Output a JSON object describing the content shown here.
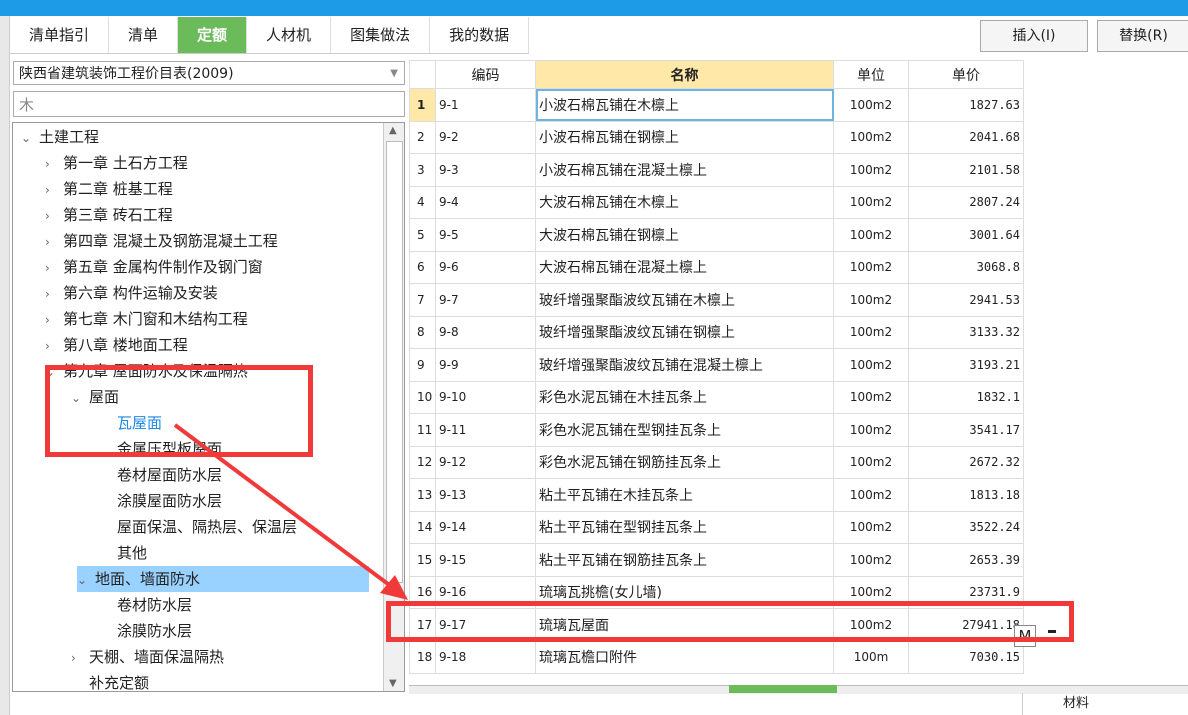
{
  "tabs": [
    "清单指引",
    "清单",
    "定额",
    "人材机",
    "图集做法",
    "我的数据"
  ],
  "active_tab": 2,
  "buttons": {
    "insert": "插入(I)",
    "replace": "替换(R)"
  },
  "library": "陕西省建筑装饰工程价目表(2009)",
  "search_value": "木",
  "tree": [
    {
      "label": "土建工程",
      "level": 0,
      "caret": "down"
    },
    {
      "label": "第一章 土石方工程",
      "level": 1,
      "caret": "right"
    },
    {
      "label": "第二章 桩基工程",
      "level": 1,
      "caret": "right"
    },
    {
      "label": "第三章 砖石工程",
      "level": 1,
      "caret": "right"
    },
    {
      "label": "第四章 混凝土及钢筋混凝土工程",
      "level": 1,
      "caret": "right"
    },
    {
      "label": "第五章 金属构件制作及钢门窗",
      "level": 1,
      "caret": "right"
    },
    {
      "label": "第六章 构件运输及安装",
      "level": 1,
      "caret": "right"
    },
    {
      "label": "第七章 木门窗和木结构工程",
      "level": 1,
      "caret": "right"
    },
    {
      "label": "第八章 楼地面工程",
      "level": 1,
      "caret": "right"
    },
    {
      "label": "第九章 屋面防水及保温隔热",
      "level": 1,
      "caret": "down"
    },
    {
      "label": "屋面",
      "level": 2,
      "caret": "down"
    },
    {
      "label": "瓦屋面",
      "level": 3,
      "caret": "",
      "state": "link"
    },
    {
      "label": "金属压型板屋面",
      "level": 3,
      "caret": ""
    },
    {
      "label": "卷材屋面防水层",
      "level": 3,
      "caret": ""
    },
    {
      "label": "涂膜屋面防水层",
      "level": 3,
      "caret": ""
    },
    {
      "label": "屋面保温、隔热层、保温层",
      "level": 3,
      "caret": ""
    },
    {
      "label": "其他",
      "level": 3,
      "caret": ""
    },
    {
      "label": "地面、墙面防水",
      "level": 2,
      "caret": "down",
      "state": "sel"
    },
    {
      "label": "卷材防水层",
      "level": 3,
      "caret": ""
    },
    {
      "label": "涂膜防水层",
      "level": 3,
      "caret": ""
    },
    {
      "label": "天棚、墙面保温隔热",
      "level": 2,
      "caret": "right"
    },
    {
      "label": "补充定额",
      "level": 2,
      "caret": ""
    }
  ],
  "grid": {
    "headers": [
      "",
      "编码",
      "名称",
      "单位",
      "单价"
    ],
    "rows": [
      [
        "1",
        "9-1",
        "小波石棉瓦铺在木檩上",
        "100m2",
        "1827.63"
      ],
      [
        "2",
        "9-2",
        "小波石棉瓦铺在钢檩上",
        "100m2",
        "2041.68"
      ],
      [
        "3",
        "9-3",
        "小波石棉瓦铺在混凝土檩上",
        "100m2",
        "2101.58"
      ],
      [
        "4",
        "9-4",
        "大波石棉瓦铺在木檩上",
        "100m2",
        "2807.24"
      ],
      [
        "5",
        "9-5",
        "大波石棉瓦铺在钢檩上",
        "100m2",
        "3001.64"
      ],
      [
        "6",
        "9-6",
        "大波石棉瓦铺在混凝土檩上",
        "100m2",
        "3068.8"
      ],
      [
        "7",
        "9-7",
        "玻纤增强聚酯波纹瓦铺在木檩上",
        "100m2",
        "2941.53"
      ],
      [
        "8",
        "9-8",
        "玻纤增强聚酯波纹瓦铺在钢檩上",
        "100m2",
        "3133.32"
      ],
      [
        "9",
        "9-9",
        "玻纤增强聚酯波纹瓦铺在混凝土檩上",
        "100m2",
        "3193.21"
      ],
      [
        "10",
        "9-10",
        "彩色水泥瓦铺在木挂瓦条上",
        "100m2",
        "1832.1"
      ],
      [
        "11",
        "9-11",
        "彩色水泥瓦铺在型钢挂瓦条上",
        "100m2",
        "3541.17"
      ],
      [
        "12",
        "9-12",
        "彩色水泥瓦铺在钢筋挂瓦条上",
        "100m2",
        "2672.32"
      ],
      [
        "13",
        "9-13",
        "粘土平瓦铺在木挂瓦条上",
        "100m2",
        "1813.18"
      ],
      [
        "14",
        "9-14",
        "粘土平瓦铺在型钢挂瓦条上",
        "100m2",
        "3522.24"
      ],
      [
        "15",
        "9-15",
        "粘土平瓦铺在钢筋挂瓦条上",
        "100m2",
        "2653.39"
      ],
      [
        "16",
        "9-16",
        "琉璃瓦挑檐(女儿墙)",
        "100m2",
        "23731.9"
      ],
      [
        "17",
        "9-17",
        "琉璃瓦屋面",
        "100m2",
        "27941.18"
      ],
      [
        "18",
        "9-18",
        "琉璃瓦檐口附件",
        "100m",
        "7030.15"
      ]
    ]
  },
  "ime_badge": "M",
  "bottom_label": "材料",
  "colors": {
    "accent": "#6cbb5a",
    "highlight": "#f03a3a",
    "selection": "#99d1ff",
    "title_bar": "#1e9be6"
  }
}
